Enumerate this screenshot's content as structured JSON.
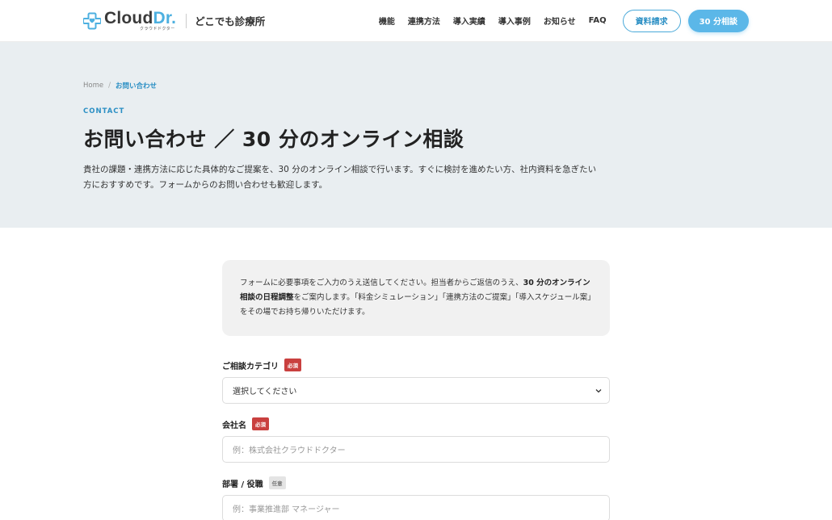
{
  "header": {
    "logo_main": "Cloud",
    "logo_dr": "Dr.",
    "logo_sub": "クラウドドクター",
    "logo_tag": "どこでも診療所",
    "nav": [
      "機能",
      "連携方法",
      "導入実績",
      "導入事例",
      "お知らせ",
      "FAQ"
    ],
    "btn_docs": "資料請求",
    "btn_consult": "30 分相談"
  },
  "hero": {
    "breadcrumb_home": "Home",
    "breadcrumb_sep": "/",
    "breadcrumb_current": "お問い合わせ",
    "eyebrow": "CONTACT",
    "title": "お問い合わせ ／ 30 分のオンライン相談",
    "lead": "貴社の課題・連携方法に応じた具体的なご提案を、30 分のオンライン相談で行います。すぐに検討を進めたい方、社内資料を急ぎたい方におすすめです。フォームからのお問い合わせも歓迎します。"
  },
  "notice": {
    "part1": "フォームに必要事項をご入力のうえ送信してください。担当者からご返信のうえ、",
    "bold": "30 分のオンライン相談の日程調整",
    "part2": "をご案内します。「料金シミュレーション」「連携方法のご提案」「導入スケジュール案」をその場でお持ち帰りいただけます。"
  },
  "form": {
    "category": {
      "label": "ご相談カテゴリ",
      "badge": "必須",
      "value": "選択してください"
    },
    "company": {
      "label": "会社名",
      "badge": "必須",
      "placeholder": "例：株式会社クラウドドクター"
    },
    "dept": {
      "label": "部署 / 役職",
      "badge": "任意",
      "placeholder": "例：事業推進部 マネージャー"
    }
  },
  "colors": {
    "accent": "#4db0e0",
    "required": "#c9403f",
    "hero_bg": "#e9eef1"
  }
}
